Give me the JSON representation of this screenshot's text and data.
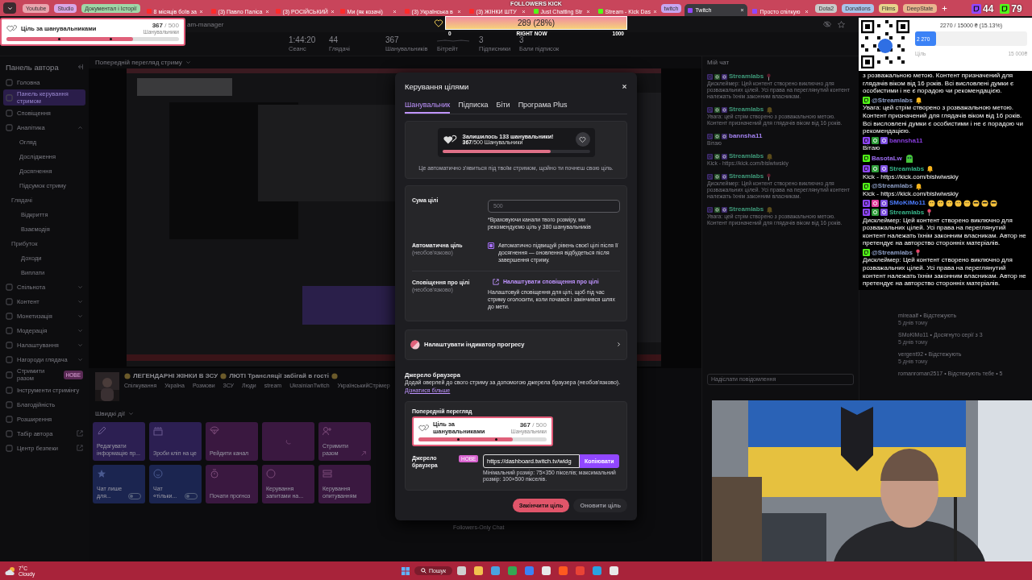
{
  "browser": {
    "tabs": [
      {
        "kind": "bookmark",
        "label": "Youtube",
        "color": "#e9a3ad"
      },
      {
        "kind": "bookmark",
        "label": "Studio",
        "color": "#d9a6e6"
      },
      {
        "kind": "bookmark",
        "label": "Документал і Історії",
        "color": "#9fd6a7"
      },
      {
        "kind": "tab",
        "label": "8 місяців боїв за",
        "selected": false,
        "color": "#ff2a2a"
      },
      {
        "kind": "tab",
        "label": "(3) Павло Паліса",
        "selected": false,
        "color": "#ff2a2a"
      },
      {
        "kind": "tab",
        "label": "(3) РОСІЙСЬКИЙ",
        "selected": false,
        "color": "#ff2a2a"
      },
      {
        "kind": "tab",
        "label": "Ми (як козачі)",
        "selected": false,
        "color": "#ff2a2a"
      },
      {
        "kind": "tab",
        "label": "(3) Українська в",
        "selected": false,
        "color": "#ff2a2a"
      },
      {
        "kind": "tab",
        "label": "(3) ЖІНКИ ШТУ",
        "selected": false,
        "color": "#ff2a2a"
      },
      {
        "kind": "tab",
        "label": "Just Chatting Str",
        "selected": false,
        "color": "#53fc18"
      },
      {
        "kind": "tab",
        "label": "Stream - Kick Das",
        "selected": false,
        "color": "#53fc18"
      },
      {
        "kind": "bookmark",
        "label": "twitch",
        "color": "#c7a6f0"
      },
      {
        "kind": "tab",
        "label": "Twitch",
        "selected": true,
        "color": "#9146ff"
      },
      {
        "kind": "tab",
        "label": "Просто спілкую",
        "selected": false,
        "color": "#9146ff"
      },
      {
        "kind": "bookmark",
        "label": "Dota2",
        "color": "#c9c9c9"
      },
      {
        "kind": "bookmark",
        "label": "Donations",
        "color": "#a9c3ea"
      },
      {
        "kind": "bookmark",
        "label": "Films",
        "color": "#e8d38c"
      },
      {
        "kind": "bookmark",
        "label": "DeepState",
        "color": "#e9b48f"
      }
    ],
    "address": "am-manager"
  },
  "follower_goal_overlay": {
    "title": "Ціль за шанувальниками",
    "count": "**367** / 500",
    "unit": "Шанувальники",
    "level": 0.734
  },
  "kick_followers_overlay": {
    "title": "FOLLOWERS KICK",
    "reading": "289 (28%)",
    "min": "0",
    "caption": "RIGHT NOW",
    "max": "1000"
  },
  "viewer_counts": [
    {
      "platform": {
        "color": "#9146ff"
      },
      "count": "44"
    },
    {
      "platform": {
        "color": "#53fc18"
      },
      "count": "79"
    }
  ],
  "donation_overlay": {
    "summary": "2270 / 15000 ₴ (15.13%)",
    "amount": "2 270",
    "level": 0.15,
    "goal_label": "Ціль",
    "goal": "15 000₴"
  },
  "stats": [
    {
      "kind": "number",
      "value": "1:44:20",
      "label": "Сеанс"
    },
    {
      "kind": "number",
      "value": "44",
      "label": "Глядачі"
    },
    {
      "kind": "number",
      "value": "367",
      "label": "Шанувальників"
    },
    {
      "kind": "graph",
      "label": "Бітрейт"
    },
    {
      "kind": "number",
      "value": "3",
      "label": "Підписники"
    },
    {
      "kind": "number",
      "value": "3",
      "label": "Бали підписок"
    }
  ],
  "sidebar": {
    "title": "Панель автора",
    "items": [
      {
        "kind": "item",
        "label": "Головна",
        "selected": false
      },
      {
        "kind": "item",
        "label": "Панель керування стримом",
        "selected": true
      },
      {
        "kind": "item",
        "label": "Сповіщення",
        "selected": false
      },
      {
        "kind": "group",
        "label": "Аналітика",
        "selected": false,
        "expanded": true,
        "children": [
          {
            "kind": "item",
            "label": "Огляд",
            "selected": false
          },
          {
            "kind": "item",
            "label": "Дослідження",
            "selected": false
          },
          {
            "kind": "item",
            "label": "Досягнення",
            "selected": false
          },
          {
            "kind": "item",
            "label": "Підсумок стриму",
            "selected": false
          },
          {
            "kind": "heading",
            "label": "Глядачі",
            "children": [
              {
                "label": "Відкриття",
                "selected": false
              },
              {
                "label": "Взаємодія",
                "selected": false
              }
            ]
          },
          {
            "kind": "heading",
            "label": "Прибуток",
            "children": [
              {
                "label": "Доходи",
                "selected": false
              },
              {
                "label": "Виплати",
                "selected": false
              }
            ]
          }
        ]
      },
      {
        "kind": "group",
        "label": "Спільнота",
        "selected": false,
        "expanded": false
      },
      {
        "kind": "group",
        "label": "Контент",
        "selected": false,
        "expanded": false
      },
      {
        "kind": "group",
        "label": "Монетизація",
        "selected": false,
        "expanded": false
      },
      {
        "kind": "group",
        "label": "Модерація",
        "selected": false,
        "expanded": false
      },
      {
        "kind": "group",
        "label": "Налаштування",
        "selected": false,
        "expanded": false
      },
      {
        "kind": "group",
        "label": "Нагороди глядача",
        "selected": false,
        "expanded": false
      },
      {
        "kind": "item",
        "label": "Стримити разом",
        "selected": false,
        "badge": "НОВЕ"
      },
      {
        "kind": "item",
        "label": "Інструменти стримінгу",
        "selected": false
      },
      {
        "kind": "item",
        "label": "Благодійність",
        "selected": false
      },
      {
        "kind": "item",
        "label": "Розширення",
        "selected": false
      },
      {
        "kind": "external",
        "label": "Табір автора",
        "selected": false
      },
      {
        "kind": "external",
        "label": "Центр безпеки",
        "selected": false
      }
    ]
  },
  "center": {
    "preview_label": "Попередній перегляд стриму",
    "stream_title": [
      "ЛЕГЕНДАРНІ ЖІНКИ В ЗСУ",
      "ЛЮТІ Трансляції забігай в гості"
    ],
    "tags": [
      "Спілкування",
      "Україна",
      "Розмови",
      "ЗСУ",
      "Люди",
      "stream",
      "UkrainianTwitch",
      "УкраїнськийСтрімер"
    ],
    "quick_actions_label": "Швидкі дії",
    "tiles": [
      {
        "kind": "action",
        "label": "Редагувати інформацію пр...",
        "color": "#2c1f52"
      },
      {
        "kind": "action",
        "label": "Зроби кліп на це",
        "color": "#2c1f52"
      },
      {
        "kind": "action",
        "label": "Рейдити канал",
        "color": "#3a1840"
      },
      {
        "kind": "loading",
        "color": "#3a1840"
      },
      {
        "kind": "link",
        "label": "Стримити разом",
        "color": "#3a1840"
      },
      {
        "kind": "toggle",
        "label": "Чат лише для...",
        "on": false,
        "color": "#1b2550"
      },
      {
        "kind": "toggle",
        "label": "Чат «тільки...",
        "on": false,
        "color": "#1b2550"
      },
      {
        "kind": "action",
        "label": "Почати прогноз",
        "color": "#3a1840"
      },
      {
        "kind": "action",
        "label": "Керування запитами на...",
        "color": "#3a1840"
      },
      {
        "kind": "action",
        "label": "Керування опитуванням",
        "color": "#3a1840"
      }
    ],
    "footer": "Followers-Only Chat"
  },
  "dim_chat": {
    "title": "Мій чат",
    "messages": [
      {
        "kind": "notice",
        "platform": {
          "color": "#3d2a6e"
        },
        "badges": [
          {
            "color": "#24502a"
          },
          {
            "color": "#3d2a6e"
          }
        ],
        "author": "Streamlabs",
        "color": "#3f9a7a",
        "text": "Дисклеймер: Цей контент створено виключно для розважальних цілей. Усі права на переглянутий контент належать їхнім законним власникам."
      },
      {
        "kind": "alert",
        "platform": {
          "color": "#3d2a6e"
        },
        "badges": [
          {
            "color": "#24502a"
          },
          {
            "color": "#3d2a6e"
          }
        ],
        "author": "Streamlabs",
        "color": "#3f9a7a",
        "text": "Увага: цей стрім створено з розважальною метою. Контент призначений для глядачів віком від 16 років."
      },
      {
        "kind": "text",
        "platform": {
          "color": "#3d2a6e"
        },
        "badges": [
          {
            "color": "#24502a"
          },
          {
            "color": "#3d2a6e"
          }
        ],
        "author": "bannsha11",
        "color": "#a382f0",
        "text": "Вітаю"
      },
      {
        "kind": "alert",
        "platform": {
          "color": "#3d2a6e"
        },
        "badges": [
          {
            "color": "#24502a"
          },
          {
            "color": "#3d2a6e"
          }
        ],
        "author": "Streamlabs",
        "color": "#3f9a7a",
        "text": "Kick - https://kick.com/bislwiwskiy"
      },
      {
        "kind": "notice",
        "platform": {
          "color": "#3d2a6e"
        },
        "badges": [
          {
            "color": "#24502a"
          },
          {
            "color": "#3d2a6e"
          }
        ],
        "author": "Streamlabs",
        "color": "#3f9a7a",
        "text": "Дисклеймер: Цей контент створено виключно для розважальних цілей. Усі права на переглянутий контент належать їхнім законним власникам."
      },
      {
        "kind": "alert",
        "platform": {
          "color": "#3d2a6e"
        },
        "badges": [
          {
            "color": "#24502a"
          },
          {
            "color": "#3d2a6e"
          }
        ],
        "author": "Streamlabs",
        "color": "#3f9a7a",
        "text": "Увага: цей стрім створено з розважальною метою. Контент призначений для глядачів віком від 16 років."
      }
    ],
    "placeholder": "Надіслати повідомлення"
  },
  "activity": [
    {
      "title": "mireaalf • Відстежують",
      "time": "5 днів тому"
    },
    {
      "title": "SMoKiMo11 • Досягнуто серії з 3",
      "time": "5 днів тому"
    },
    {
      "title": "vergent92 • Відстежують",
      "time": "5 днів тому"
    },
    {
      "title": "romanroman2517 • Відстежують тебе • 5"
    }
  ],
  "chat_overlay": {
    "messages": [
      {
        "kind": "text",
        "text": "з розважальною метою. Контент призначений для глядачів віком від 16 років. Всі висловлені думки є особистими і не є порадою чи рекомендацією."
      },
      {
        "kind": "alert",
        "platform": {
          "color": "#53fc18"
        },
        "author": "@Streamlabs",
        "color": "#8fa0c8",
        "text": "Увага: цей стрім створено з розважальною метою. Контент призначений для глядачів віком від 16 років. Всі висловлені думки є особистими і не є порадою чи рекомендацією."
      },
      {
        "kind": "text",
        "platform": {
          "color": "#9146ff"
        },
        "badges": [
          {
            "color": "#2f9e3a"
          },
          {
            "color": "#7d4fe0"
          }
        ],
        "author": "bannsha11",
        "color": "#8a3fe0",
        "text": "Вітаю"
      },
      {
        "kind": "sticker",
        "platform": {
          "color": "#53fc18"
        },
        "author": "BasotaLw",
        "color": "#9c6cf0"
      },
      {
        "kind": "alert",
        "platform": {
          "color": "#9146ff"
        },
        "badges": [
          {
            "color": "#2f9e3a"
          },
          {
            "color": "#7d4fe0"
          }
        ],
        "author": "Streamlabs",
        "color": "#37b58a",
        "text": "Kick - https://kick.com/bislwiwskiy"
      },
      {
        "kind": "alert",
        "platform": {
          "color": "#53fc18"
        },
        "author": "@Streamlabs",
        "color": "#8fa0c8",
        "text": "Kick - https://kick.com/bislwiwskiy"
      },
      {
        "kind": "emotes",
        "platform": {
          "color": "#9146ff"
        },
        "badges": [
          {
            "color": "#e0409a"
          },
          {
            "color": "#7d4fe0"
          }
        ],
        "author": "SMoKiMo11",
        "color": "#4d7dff"
      },
      {
        "kind": "notice",
        "platform": {
          "color": "#9146ff"
        },
        "badges": [
          {
            "color": "#2f9e3a"
          },
          {
            "color": "#7d4fe0"
          }
        ],
        "author": "Streamlabs",
        "color": "#37b58a",
        "text": "Дисклеймер: Цей контент створено виключно для розважальних цілей. Усі права на переглянутий контент належать їхнім законним власникам. Автор не претендує на авторство сторонніх матеріалів."
      },
      {
        "kind": "notice",
        "platform": {
          "color": "#53fc18"
        },
        "author": "@Streamlabs",
        "color": "#8fa0c8",
        "text": "Дисклеймер: Цей контент створено виключно для розважальних цілей. Усі права на переглянутий контент належать їхнім законним власникам. Автор не претендує на авторство сторонніх матеріалів."
      }
    ]
  },
  "goal_modal": {
    "title": "Керування цілями",
    "tabs": [
      {
        "label": "Шанувальник",
        "selected": true
      },
      {
        "label": "Підписка",
        "selected": false
      },
      {
        "label": "Біти",
        "selected": false
      },
      {
        "label": "Програма Plus",
        "selected": false
      }
    ],
    "summary": {
      "headline": "Залишилось 133 шанувальники!",
      "count": "**367**/500 Шанувальники",
      "level": 0.734,
      "note": "Це автоматично з'явиться під твоїм стримом, щойно ти почнеш свою ціль."
    },
    "fields": [
      {
        "kind": "amount",
        "label": "Сума цілі",
        "placeholder": "500",
        "hint": "*Враховуючи канали твого розміру, ми рекомендуємо ціль у 380 шанувальників"
      },
      {
        "kind": "checkbox",
        "label": "Автоматична ціль",
        "optional": "(необов'язково)",
        "checked": true,
        "text": "Автоматично підвищуй рівень своєї цілі після її досягнення — оновлення відбудеться після завершення стриму."
      },
      {
        "kind": "link",
        "label": "Сповіщення про цілі",
        "optional": "(необов'язково)",
        "link": "Налаштувати сповіщення про цілі",
        "text": "Налаштовуй сповіщення для цілі, щоб під час стриму оголосити, коли почався і закінчився шлях до мети."
      }
    ],
    "progress_row": "Налаштувати індикатор прогресу",
    "browser_source": {
      "title": "Джерело браузера",
      "text": "Додай оверлей до свого стриму за допомогою джерела браузера (необов'язково).",
      "link": "Дізнатися більше",
      "preview_label": "Попередній перегляд",
      "preview": {
        "title": "Ціль за шанувальниками",
        "count": "**367** / 500",
        "unit": "Шанувальники",
        "level": 0.734
      },
      "field_label": "Джерело браузера",
      "badge": "НОВЕ",
      "url": "https://dashboard.twitch.tv/widg",
      "copy": "Копіювати",
      "size_note": "Мінімальний розмір: 75×350 пікселів; максимальний розмір: 100×500 пікселів."
    },
    "buttons": [
      {
        "label": "Закінчити ціль",
        "disabled": false
      },
      {
        "label": "Оновити ціль",
        "disabled": true
      }
    ]
  },
  "taskbar": {
    "temperature": "7°C",
    "weather": "Cloudy",
    "search": "Пошук"
  }
}
